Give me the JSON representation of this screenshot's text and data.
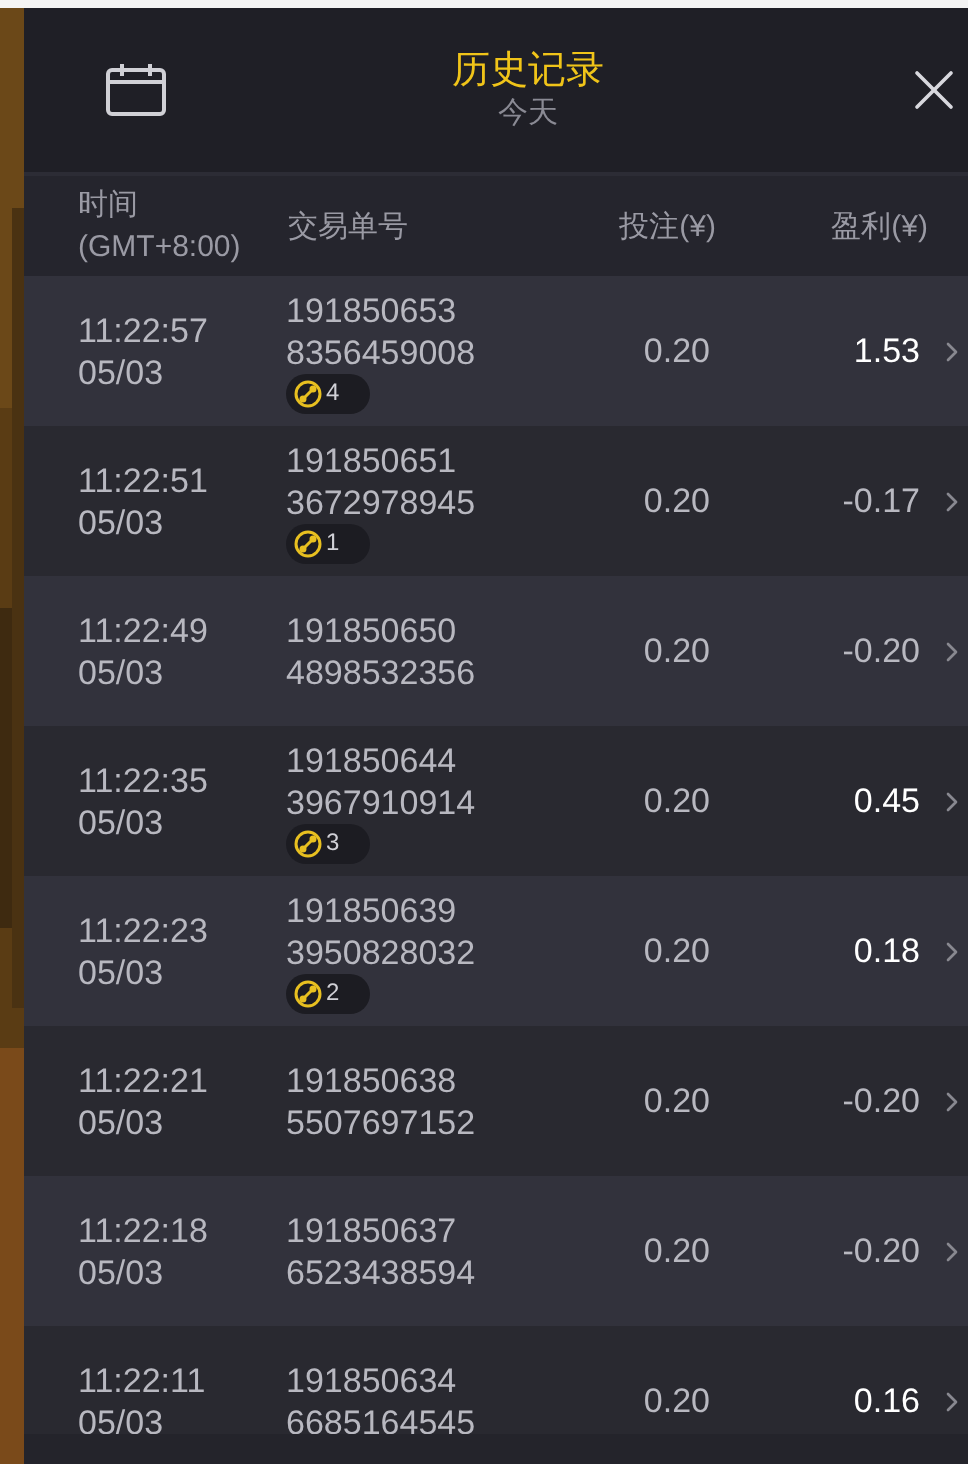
{
  "header": {
    "title": "历史记录",
    "subtitle": "今天"
  },
  "columns": [
    {
      "line1": "时间",
      "line2": "(GMT+8:00)"
    },
    {
      "line1": "交易单号"
    },
    {
      "line1": "投注(¥)"
    },
    {
      "line1": "盈利(¥)"
    }
  ],
  "rows": [
    {
      "time": "11:22:57",
      "date": "05/03",
      "order1": "191850653",
      "order2": "8356459008",
      "badge": "4",
      "stake": "0.20",
      "profit": "1.53",
      "kind": "win"
    },
    {
      "time": "11:22:51",
      "date": "05/03",
      "order1": "191850651",
      "order2": "3672978945",
      "badge": "1",
      "stake": "0.20",
      "profit": "-0.17",
      "kind": "loss"
    },
    {
      "time": "11:22:49",
      "date": "05/03",
      "order1": "191850650",
      "order2": "4898532356",
      "stake": "0.20",
      "profit": "-0.20",
      "kind": "loss"
    },
    {
      "time": "11:22:35",
      "date": "05/03",
      "order1": "191850644",
      "order2": "3967910914",
      "badge": "3",
      "stake": "0.20",
      "profit": "0.45",
      "kind": "win"
    },
    {
      "time": "11:22:23",
      "date": "05/03",
      "order1": "191850639",
      "order2": "3950828032",
      "badge": "2",
      "stake": "0.20",
      "profit": "0.18",
      "kind": "win"
    },
    {
      "time": "11:22:21",
      "date": "05/03",
      "order1": "191850638",
      "order2": "5507697152",
      "stake": "0.20",
      "profit": "-0.20",
      "kind": "loss"
    },
    {
      "time": "11:22:18",
      "date": "05/03",
      "order1": "191850637",
      "order2": "6523438594",
      "stake": "0.20",
      "profit": "-0.20",
      "kind": "loss"
    },
    {
      "time": "11:22:11",
      "date": "05/03",
      "order1": "191850634",
      "order2": "6685164545",
      "stake": "0.20",
      "profit": "0.16",
      "kind": "win"
    }
  ]
}
